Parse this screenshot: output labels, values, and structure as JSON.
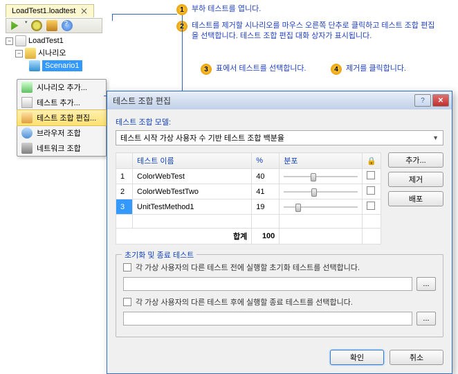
{
  "tab": {
    "title": "LoadTest1.loadtest"
  },
  "tree": {
    "root": "LoadTest1",
    "scenario_group": "시나리오",
    "scenario1": "Scenario1"
  },
  "context_menu": {
    "add_scenario": "시나리오 추가...",
    "add_test": "테스트 추가...",
    "edit_test_mix": "테스트 조합 편집...",
    "browser_mix": "브라우저 조합",
    "network_mix": "네트워크 조합"
  },
  "callouts": {
    "c1": "부하 테스트를 엽니다.",
    "c2": "테스트를 제거할 시나리오를 마우스 오른쪽 단추로 클릭하고 테스트 조합 편집을 선택합니다. 테스트 조합 편집 대화 상자가 표시됩니다.",
    "c3": "표에서 테스트를 선택합니다.",
    "c4": "제거를 클릭합니다."
  },
  "dialog": {
    "title": "테스트 조합 편집",
    "model_label": "테스트 조합 모델:",
    "model_value": "테스트 시작 가상 사용자 수 기반 테스트 조합 백분율",
    "col_name": "테스트 이름",
    "col_pct": "%",
    "col_dist": "분포",
    "rows": [
      {
        "n": "1",
        "name": "ColorWebTest",
        "pct": "40",
        "pos": 40
      },
      {
        "n": "2",
        "name": "ColorWebTestTwo",
        "pct": "41",
        "pos": 41
      },
      {
        "n": "3",
        "name": "UnitTestMethod1",
        "pct": "19",
        "pos": 19
      }
    ],
    "sum_label": "합계",
    "sum_value": "100",
    "btn_add": "추가...",
    "btn_remove": "제거",
    "btn_distribute": "배포",
    "group_title": "초기화 및 종료 테스트",
    "init_check": "각 가상 사용자의 다른 테스트 전에 실행할 초기화 테스트를 선택합니다.",
    "term_check": "각 가상 사용자의 다른 테스트 후에 실행할 종료 테스트를 선택합니다.",
    "browse": "...",
    "ok": "확인",
    "cancel": "취소"
  }
}
